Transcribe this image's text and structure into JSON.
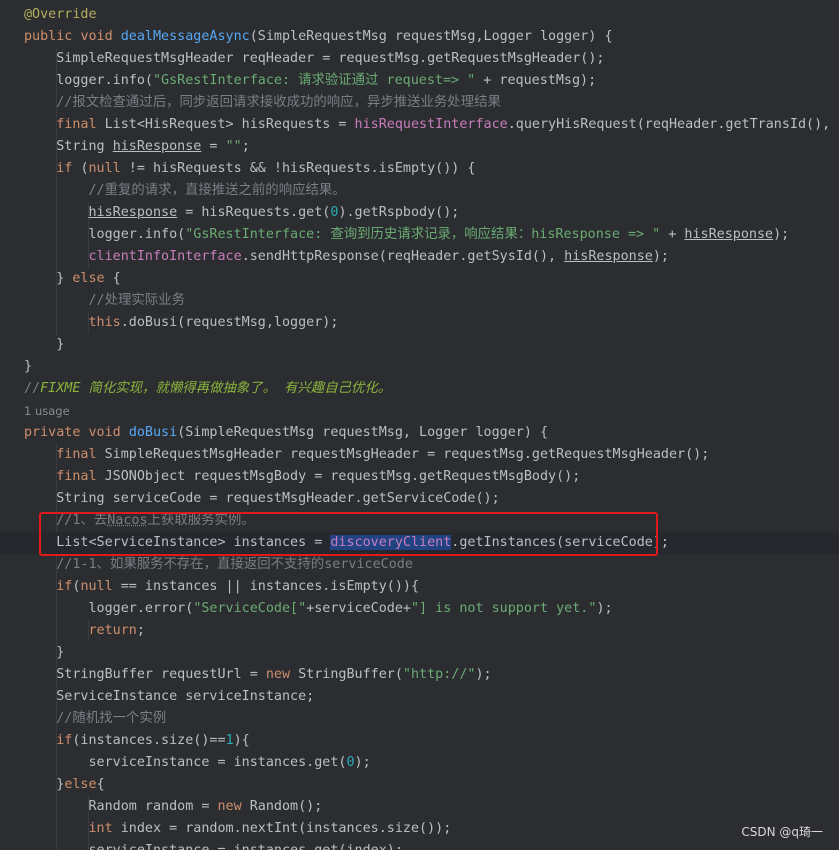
{
  "editor": {
    "lines": [
      [
        {
          "t": "@Override",
          "c": "ann"
        }
      ],
      [
        {
          "t": "public ",
          "c": "kw"
        },
        {
          "t": "void ",
          "c": "kw"
        },
        {
          "t": "dealMessageAsync",
          "c": "fn"
        },
        {
          "t": "(SimpleRequestMsg requestMsg,Logger logger) {"
        }
      ],
      [
        {
          "t": "    SimpleRequestMsgHeader reqHeader = requestMsg.getRequestMsgHeader();"
        }
      ],
      [
        {
          "t": "    logger.info("
        },
        {
          "t": "\"GsRestInterface: 请求验证通过 request=> \"",
          "c": "str"
        },
        {
          "t": " + requestMsg);"
        }
      ],
      [
        {
          "t": "    //报文检查通过后，同步返回请求接收成功的响应，异步推送业务处理结果",
          "c": "cmt"
        }
      ],
      [
        {
          "t": "    "
        },
        {
          "t": "final ",
          "c": "kw"
        },
        {
          "t": "List<HisRequest> hisRequests = "
        },
        {
          "t": "hisRequestInterface",
          "c": "field"
        },
        {
          "t": ".queryHisRequest(reqHeader.getTransId(), r"
        }
      ],
      [
        {
          "t": "    String "
        },
        {
          "t": "hisResponse",
          "c": "ul"
        },
        {
          "t": " = "
        },
        {
          "t": "\"\"",
          "c": "str"
        },
        {
          "t": ";"
        }
      ],
      [
        {
          "t": "    "
        },
        {
          "t": "if ",
          "c": "kw"
        },
        {
          "t": "("
        },
        {
          "t": "null",
          "c": "kw"
        },
        {
          "t": " != hisRequests && !hisRequests.isEmpty()) {"
        }
      ],
      [
        {
          "t": "        //重复的请求，直接推送之前的响应结果。",
          "c": "cmt"
        }
      ],
      [
        {
          "t": "        "
        },
        {
          "t": "hisResponse",
          "c": "ul"
        },
        {
          "t": " = hisRequests.get("
        },
        {
          "t": "0",
          "c": "num"
        },
        {
          "t": ").getRspbody();"
        }
      ],
      [
        {
          "t": "        logger.info("
        },
        {
          "t": "\"GsRestInterface: 查询到历史请求记录，响应结果：hisResponse => \"",
          "c": "str"
        },
        {
          "t": " + "
        },
        {
          "t": "hisResponse",
          "c": "ul"
        },
        {
          "t": ");"
        }
      ],
      [
        {
          "t": "        "
        },
        {
          "t": "clientInfoInterface",
          "c": "field"
        },
        {
          "t": ".sendHttpResponse(reqHeader.getSysId(), "
        },
        {
          "t": "hisResponse",
          "c": "ul"
        },
        {
          "t": ");"
        }
      ],
      [
        {
          "t": "    } "
        },
        {
          "t": "else",
          "c": "kw"
        },
        {
          "t": " {"
        }
      ],
      [
        {
          "t": "        //处理实际业务",
          "c": "cmt"
        }
      ],
      [
        {
          "t": "        "
        },
        {
          "t": "this",
          "c": "kw"
        },
        {
          "t": ".doBusi(requestMsg,logger);"
        }
      ],
      [
        {
          "t": "    }"
        }
      ],
      [
        {
          "t": "}"
        }
      ],
      [
        {
          "t": "//",
          "c": "cmt"
        },
        {
          "t": "FIXME 简化实现，就懒得再做抽象了。 有兴趣自己优化。",
          "c": "todo"
        }
      ],
      [
        {
          "t": "1 usage",
          "c": "usage"
        }
      ],
      [
        {
          "t": "private ",
          "c": "kw"
        },
        {
          "t": "void ",
          "c": "kw"
        },
        {
          "t": "doBusi",
          "c": "fn"
        },
        {
          "t": "(SimpleRequestMsg requestMsg, Logger logger) {"
        }
      ],
      [
        {
          "t": "    "
        },
        {
          "t": "final ",
          "c": "kw"
        },
        {
          "t": "SimpleRequestMsgHeader requestMsgHeader = requestMsg.getRequestMsgHeader();"
        }
      ],
      [
        {
          "t": "    "
        },
        {
          "t": "final ",
          "c": "kw"
        },
        {
          "t": "JSONObject requestMsgBody = requestMsg.getRequestMsgBody();"
        }
      ],
      [
        {
          "t": "    String serviceCode = requestMsgHeader.getServiceCode();"
        }
      ],
      [
        {
          "t": "    //1、去",
          "c": "cmt"
        },
        {
          "t": "Nacos",
          "c": "cmt ul-cmt"
        },
        {
          "t": "上获取服务实例。",
          "c": "cmt"
        }
      ],
      [
        {
          "t": "    List<ServiceInstance> instances = "
        },
        {
          "t": "discoveryClient",
          "c": "field sel"
        },
        {
          "t": ".getInstances(serviceCode);"
        }
      ],
      [
        {
          "t": "    //1-1、如果服务不存在，直接返回不支持的serviceCode",
          "c": "cmt"
        }
      ],
      [
        {
          "t": "    "
        },
        {
          "t": "if",
          "c": "kw"
        },
        {
          "t": "("
        },
        {
          "t": "null",
          "c": "kw"
        },
        {
          "t": " == instances || instances.isEmpty()){"
        }
      ],
      [
        {
          "t": "        logger.error("
        },
        {
          "t": "\"ServiceCode[\"",
          "c": "str"
        },
        {
          "t": "+serviceCode+"
        },
        {
          "t": "\"] is not support yet.\"",
          "c": "str"
        },
        {
          "t": ");"
        }
      ],
      [
        {
          "t": "        "
        },
        {
          "t": "return",
          "c": "kw"
        },
        {
          "t": ";"
        }
      ],
      [
        {
          "t": "    }"
        }
      ],
      [
        {
          "t": "    StringBuffer requestUrl = "
        },
        {
          "t": "new ",
          "c": "kw"
        },
        {
          "t": "StringBuffer("
        },
        {
          "t": "\"http://\"",
          "c": "str"
        },
        {
          "t": ");"
        }
      ],
      [
        {
          "t": "    ServiceInstance serviceInstance;"
        }
      ],
      [
        {
          "t": "    //随机找一个实例",
          "c": "cmt"
        }
      ],
      [
        {
          "t": "    "
        },
        {
          "t": "if",
          "c": "kw"
        },
        {
          "t": "(instances.size()=="
        },
        {
          "t": "1",
          "c": "num"
        },
        {
          "t": "){"
        }
      ],
      [
        {
          "t": "        serviceInstance = instances.get("
        },
        {
          "t": "0",
          "c": "num"
        },
        {
          "t": ");"
        }
      ],
      [
        {
          "t": "    }"
        },
        {
          "t": "else",
          "c": "kw"
        },
        {
          "t": "{"
        }
      ],
      [
        {
          "t": "        Random random = "
        },
        {
          "t": "new ",
          "c": "kw"
        },
        {
          "t": "Random();"
        }
      ],
      [
        {
          "t": "        "
        },
        {
          "t": "int ",
          "c": "kw"
        },
        {
          "t": "index = random.nextInt(instances.size());"
        }
      ],
      [
        {
          "t": "        serviceInstance = instances.get(index);"
        }
      ]
    ],
    "caret_line": 24
  },
  "watermark": "CSDN @q琦一"
}
